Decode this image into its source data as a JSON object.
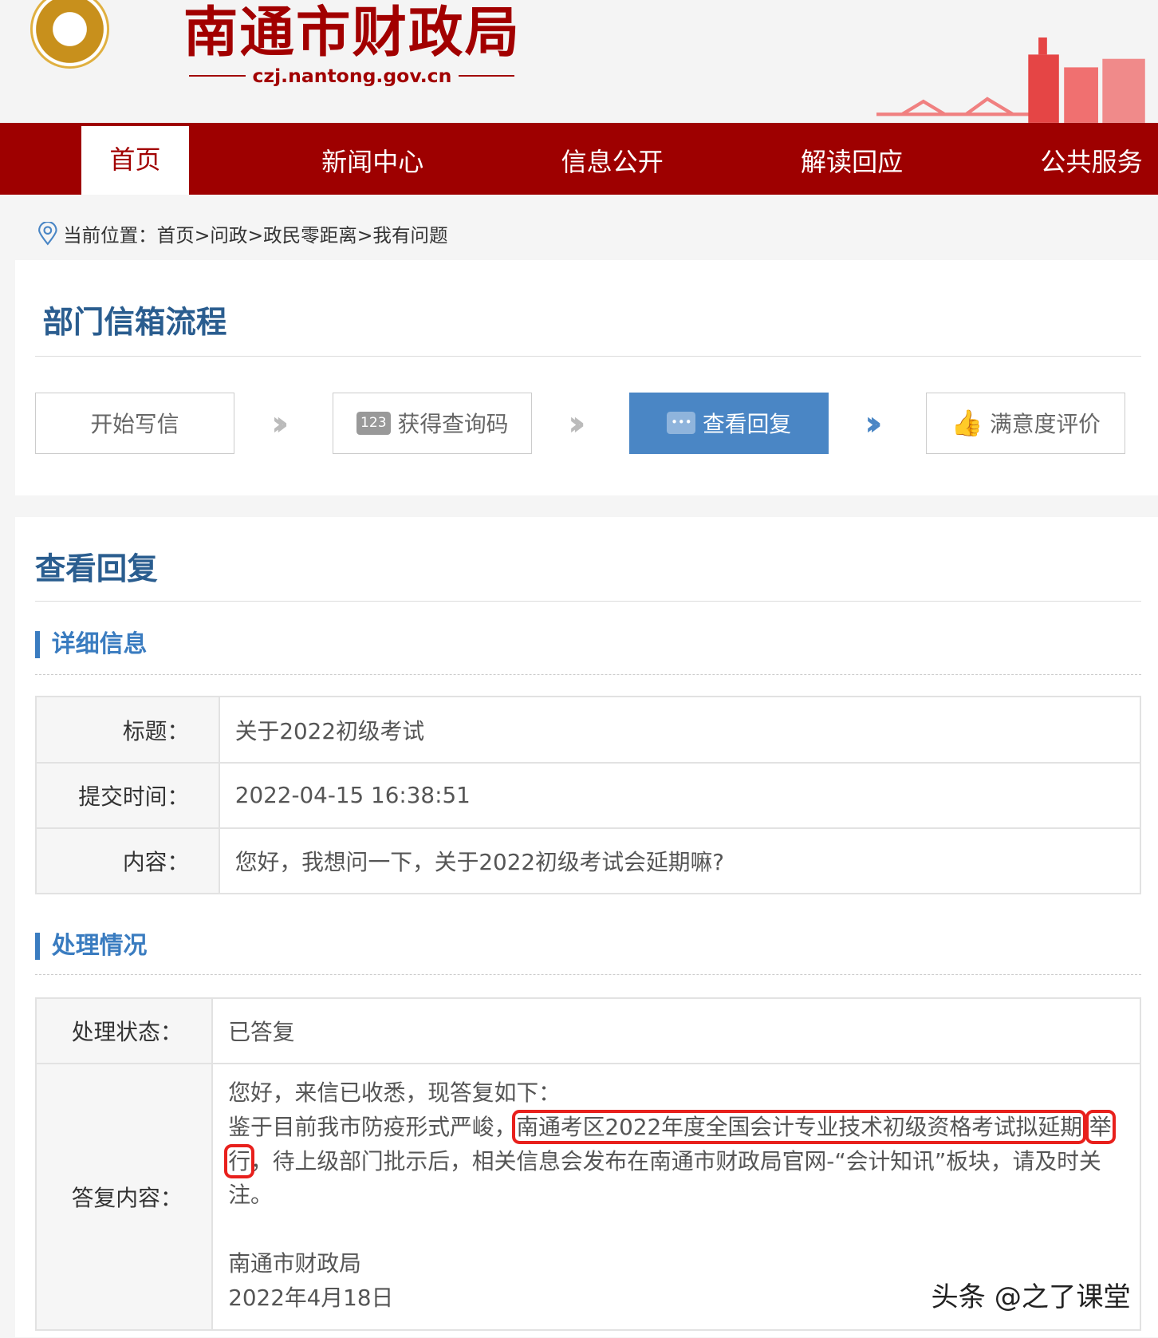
{
  "header": {
    "title": "南通市财政局",
    "url": "czj.nantong.gov.cn"
  },
  "nav": [
    "首页",
    "新闻中心",
    "信息公开",
    "解读回应",
    "公共服务"
  ],
  "breadcrumb": "当前位置：首页>问政>政民零距离>我有问题",
  "flow": {
    "title": "部门信箱流程",
    "steps": [
      "开始写信",
      "获得查询码",
      "查看回复",
      "满意度评价"
    ],
    "code_icon_text": "123"
  },
  "view": {
    "title": "查看回复",
    "detail": {
      "title": "详细信息",
      "rows": [
        {
          "k": "标题：",
          "v": "关于2022初级考试"
        },
        {
          "k": "提交时间：",
          "v": "2022-04-15 16:38:51"
        },
        {
          "k": "内容：",
          "v": "您好，我想问一下，关于2022初级考试会延期嘛?"
        }
      ]
    },
    "process": {
      "title": "处理情况",
      "status_label": "处理状态：",
      "status": "已答复",
      "reply_label": "答复内容：",
      "reply": {
        "l1": "您好，来信已收悉，现答复如下：",
        "l2a": "鉴于目前我市防疫形式严峻，",
        "l2b": "南通考区2022年度全国会计专业技术初级资格考试拟延期",
        "l2c": "举行",
        "l2d": "，待上级部门批示后，相关信息会发布在南通市财政局官网-“会计知讯”板块，请及时关注。",
        "sign": "南通市财政局",
        "date": "2022年4月18日"
      }
    }
  },
  "watermark": "头条 @之了课堂",
  "colors": {
    "brand": "#9e0000",
    "accent": "#4a86c5",
    "highlight": "#e8201c"
  }
}
